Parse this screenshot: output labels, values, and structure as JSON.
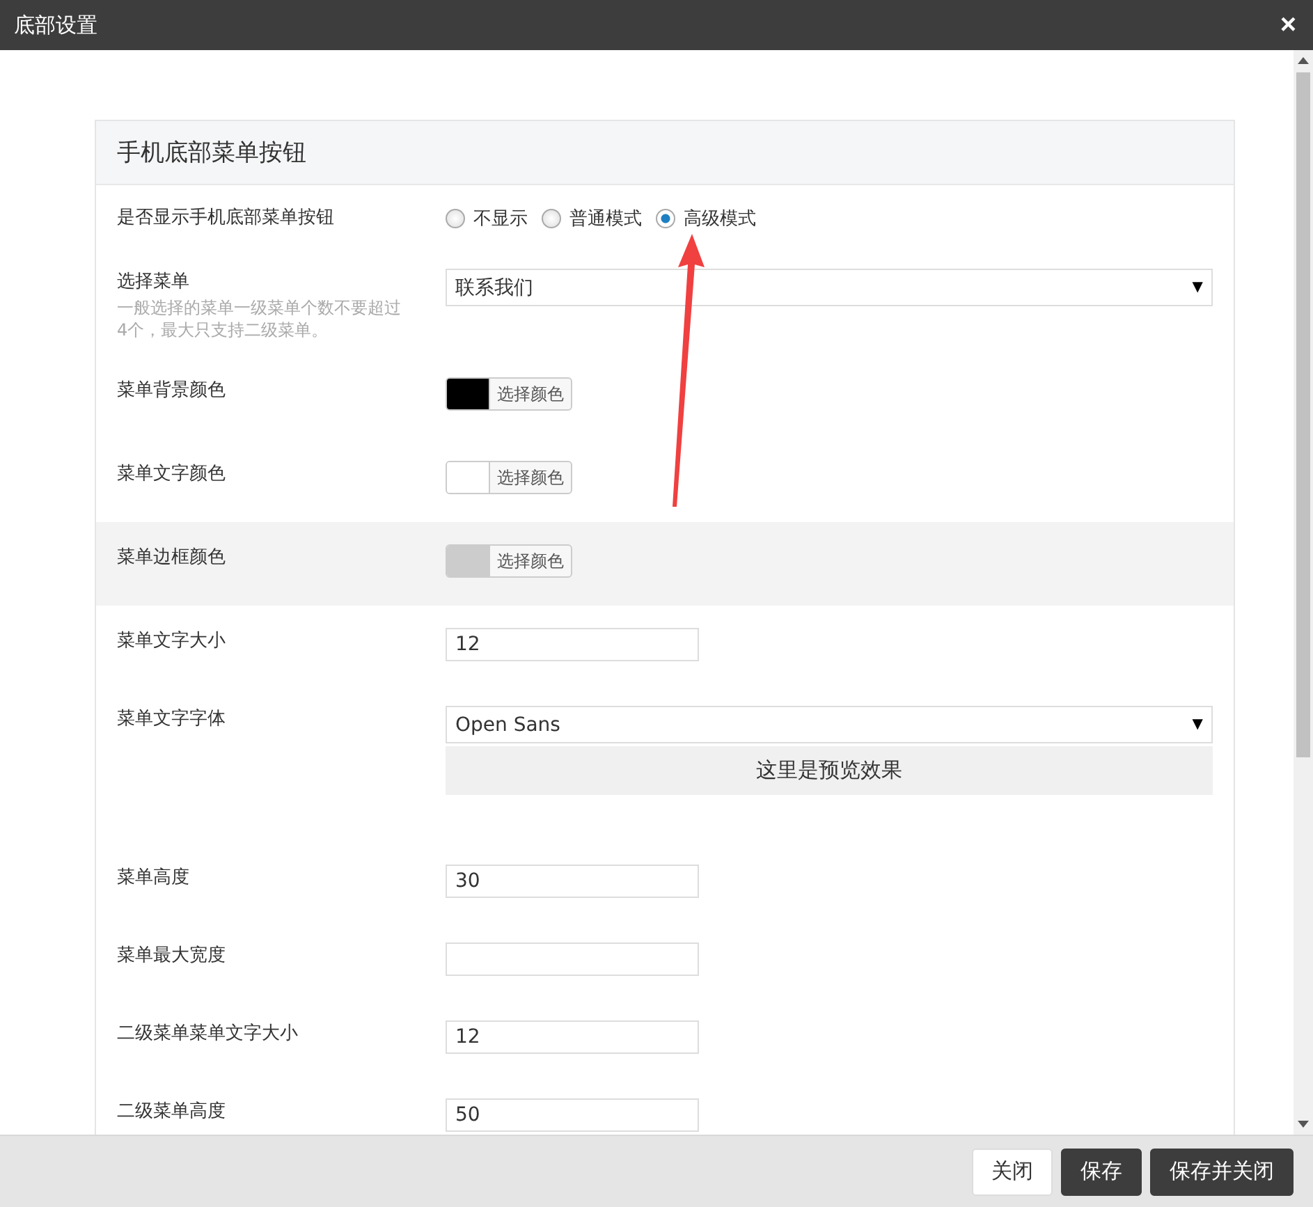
{
  "window": {
    "title": "底部设置",
    "close": "×"
  },
  "panel": {
    "title": "手机底部菜单按钮",
    "rows": [
      {
        "kind": "radio",
        "label": "是否显示手机底部菜单按钮",
        "highlighted": false,
        "options": [
          {
            "label": "不显示",
            "selected": false
          },
          {
            "label": "普通模式",
            "selected": false
          },
          {
            "label": "高级模式",
            "selected": true
          }
        ]
      },
      {
        "kind": "select",
        "label": "选择菜单",
        "hint": "一般选择的菜单一级菜单个数不要超过4个，最大只支持二级菜单。",
        "highlighted": false,
        "value": "联系我们",
        "caret": "▼"
      },
      {
        "kind": "color",
        "label": "菜单背景颜色",
        "highlighted": false,
        "color": "#000000",
        "button": "选择颜色"
      },
      {
        "kind": "color",
        "label": "菜单文字颜色",
        "highlighted": false,
        "color": "#ffffff",
        "button": "选择颜色"
      },
      {
        "kind": "color",
        "label": "菜单边框颜色",
        "highlighted": true,
        "color": "#cccccc",
        "button": "选择颜色"
      },
      {
        "kind": "input",
        "label": "菜单文字大小",
        "highlighted": false,
        "value": "12"
      },
      {
        "kind": "font",
        "label": "菜单文字字体",
        "highlighted": false,
        "value": "Open Sans",
        "caret": "▼",
        "preview": "这里是预览效果"
      },
      {
        "kind": "input",
        "label": "菜单高度",
        "highlighted": false,
        "value": "30"
      },
      {
        "kind": "input",
        "label": "菜单最大宽度",
        "highlighted": false,
        "value": ""
      },
      {
        "kind": "input",
        "label": "二级菜单菜单文字大小",
        "highlighted": false,
        "value": "12"
      },
      {
        "kind": "input",
        "label": "二级菜单高度",
        "highlighted": false,
        "value": "50"
      }
    ]
  },
  "buttons": [
    {
      "label": "关闭",
      "kind": "plain"
    },
    {
      "label": "保存",
      "kind": "dark"
    },
    {
      "label": "保存并关闭",
      "kind": "dark"
    }
  ]
}
